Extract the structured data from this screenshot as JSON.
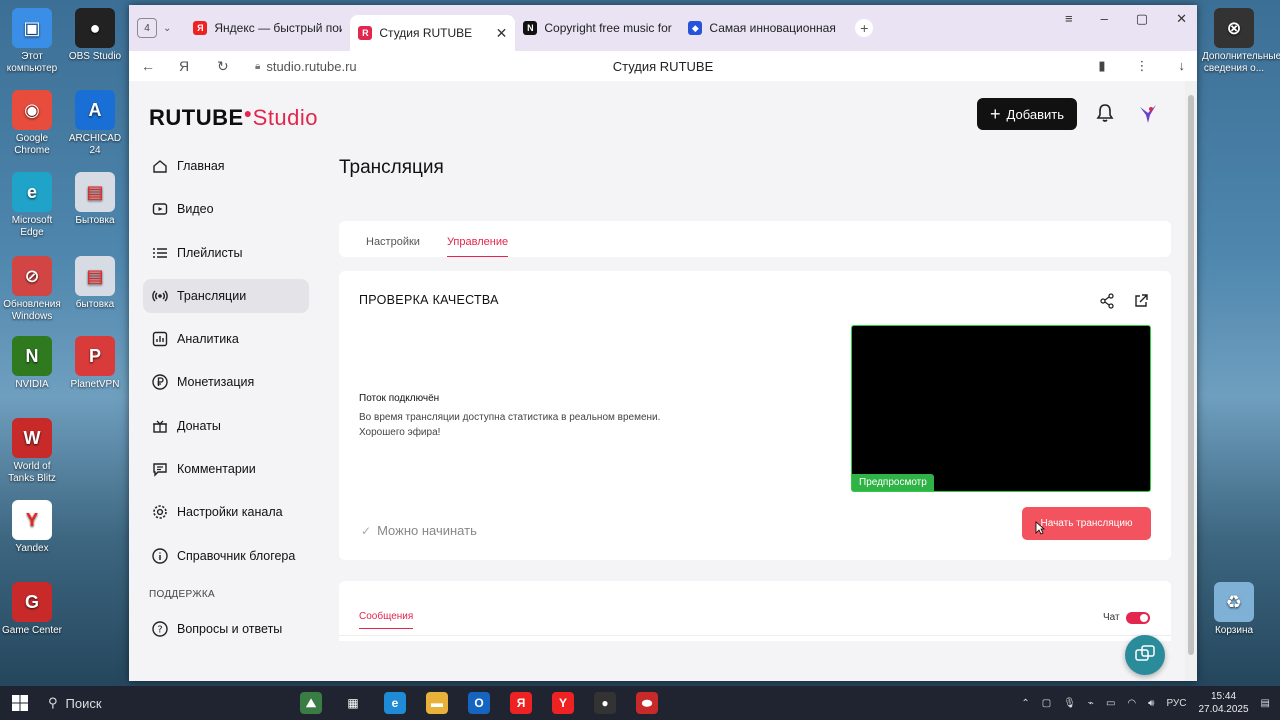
{
  "desktop": {
    "icons_left": [
      {
        "label": "Этот компьютер",
        "color": "#3a8ee6",
        "glyph": "▣"
      },
      {
        "label": "OBS Studio",
        "color": "#222",
        "glyph": "●"
      },
      {
        "label": "Google Chrome",
        "color": "#e74c3c",
        "glyph": "◉"
      },
      {
        "label": "ARCHICAD 24",
        "color": "#1a6fd6",
        "glyph": "A"
      },
      {
        "label": "Microsoft Edge",
        "color": "#1fa3c9",
        "glyph": "e"
      },
      {
        "label": "Бытовка",
        "color": "#d7dbe3",
        "glyph": "▤"
      },
      {
        "label": "Обновления Windows",
        "color": "#d24545",
        "glyph": "⊘"
      },
      {
        "label": "бытовка",
        "color": "#d7dbe3",
        "glyph": "▤"
      },
      {
        "label": "NVIDIA",
        "color": "#2f7a1f",
        "glyph": "N"
      },
      {
        "label": "PlanetVPN",
        "color": "#d93b3b",
        "glyph": "P"
      },
      {
        "label": "World of Tanks Blitz",
        "color": "#c82a2a",
        "glyph": "W"
      },
      {
        "label": "Yandex",
        "color": "#fff",
        "glyph": "Y"
      },
      {
        "label": "Game Center",
        "color": "#c82a2a",
        "glyph": "G"
      }
    ],
    "icons_right": [
      {
        "label": "Дополнительные сведения о...",
        "color": "#333",
        "glyph": "⊗"
      },
      {
        "label": "Корзина",
        "color": "#7fb1d6",
        "glyph": "♻"
      }
    ]
  },
  "browser": {
    "tab_count": "4",
    "tabs": [
      {
        "title": "Яндекс — быстрый поиск",
        "fav_color": "#e22",
        "fav_glyph": "Я",
        "active": false
      },
      {
        "title": "Студия RUTUBE",
        "fav_color": "#e3264d",
        "fav_glyph": "R",
        "active": true
      },
      {
        "title": "Copyright free music for c",
        "fav_color": "#111",
        "fav_glyph": "N",
        "active": false
      },
      {
        "title": "Самая инновационная то",
        "fav_color": "#2553d9",
        "fav_glyph": "◆",
        "active": false
      }
    ],
    "url": "studio.rutube.ru",
    "page_title": "Студия RUTUBE"
  },
  "app": {
    "logo_main": "RUTUBE",
    "logo_studio": "Studio",
    "add_label": "Добавить",
    "sidebar": [
      {
        "label": "Главная",
        "icon": "home-icon",
        "active": false
      },
      {
        "label": "Видео",
        "icon": "video-icon",
        "active": false
      },
      {
        "label": "Плейлисты",
        "icon": "playlist-icon",
        "active": false
      },
      {
        "label": "Трансляции",
        "icon": "broadcast-icon",
        "active": true
      },
      {
        "label": "Аналитика",
        "icon": "analytics-icon",
        "active": false
      },
      {
        "label": "Монетизация",
        "icon": "ruble-icon",
        "active": false
      },
      {
        "label": "Донаты",
        "icon": "donate-icon",
        "active": false
      },
      {
        "label": "Комментарии",
        "icon": "comments-icon",
        "active": false
      },
      {
        "label": "Настройки канала",
        "icon": "gear-icon",
        "active": false
      },
      {
        "label": "Справочник блогера",
        "icon": "info-icon",
        "active": false
      }
    ],
    "support_section": "ПОДДЕРЖКА",
    "support_item": "Вопросы и ответы",
    "page_heading": "Трансляция",
    "tabs": {
      "settings": "Настройки",
      "manage": "Управление"
    },
    "quality": {
      "title": "ПРОВЕРКА КАЧЕСТВА",
      "status": "Поток подключён",
      "desc_line1": "Во время трансляции доступна статистика в реальном времени.",
      "desc_line2": "Хорошего эфира!",
      "preview_badge": "Предпросмотр",
      "ready_label": "Можно начинать",
      "start_button": "Начать трансляцию"
    },
    "chat": {
      "messages_tab": "Сообщения",
      "chat_label": "Чат",
      "chat_enabled": true
    }
  },
  "taskbar": {
    "search_label": "Поиск",
    "lang": "РУС",
    "time": "15:44",
    "date": "27.04.2025"
  },
  "colors": {
    "accent": "#e3264d",
    "start_button": "#f2535e",
    "preview_badge": "#2fb346"
  }
}
